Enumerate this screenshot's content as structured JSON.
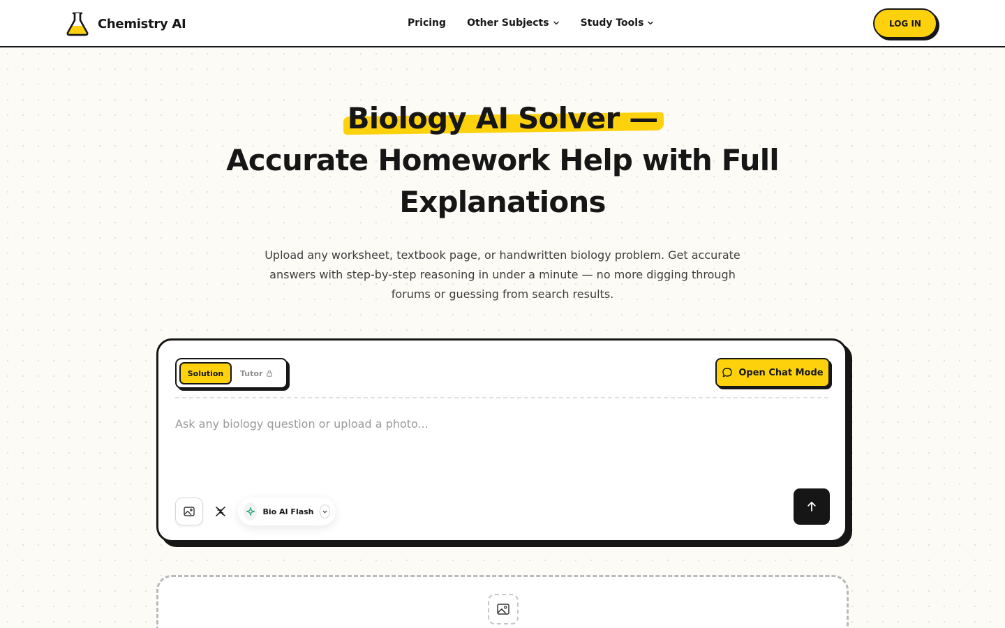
{
  "brand": {
    "name": "Chemistry AI",
    "logo_icon": "flask-icon",
    "accent": "#fdd20d"
  },
  "nav": {
    "items": [
      {
        "label": "Pricing",
        "has_dropdown": false
      },
      {
        "label": "Other Subjects",
        "has_dropdown": true
      },
      {
        "label": "Study Tools",
        "has_dropdown": true
      }
    ],
    "login_label": "LOG IN"
  },
  "hero": {
    "title_highlight": "Biology AI Solver —",
    "title_line2": "Accurate Homework Help with Full",
    "title_line3": "Explanations",
    "subtitle": "Upload any worksheet, textbook page, or handwritten biology problem. Get accurate answers with step-by-step reasoning in under a minute — no more digging through forums or guessing from search results."
  },
  "solver": {
    "modes": {
      "active": "Solution",
      "locked": "Tutor"
    },
    "chat_button_label": "Open Chat Mode",
    "input_placeholder": "Ask any biology question or upload a photo...",
    "model": {
      "selected": "Bio AI Flash",
      "icon": "sparkle-icon"
    },
    "icons": {
      "upload": "image-icon",
      "dna": "dna-icon",
      "send": "arrow-up-icon",
      "lock": "lock-icon",
      "chat": "chat-bubble-icon"
    }
  },
  "dropzone": {
    "icon": "image-icon"
  },
  "colors": {
    "accent": "#fdd20d",
    "ink": "#161616",
    "background": "#fcfbf6"
  }
}
